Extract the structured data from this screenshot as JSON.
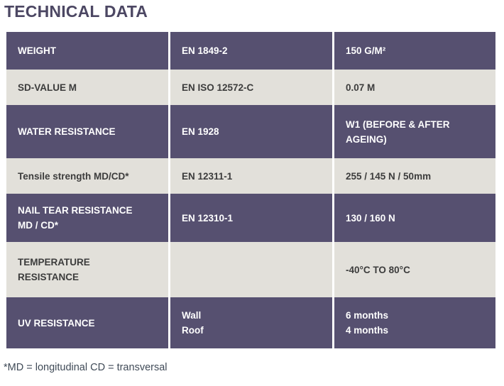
{
  "header": {
    "title": "TECHNICAL DATA"
  },
  "colors": {
    "band_purple": "#565070",
    "band_light": "#e2e0da",
    "title_text": "#4c4763",
    "light_row_text": "#3c3c3c",
    "muted_text": "#4a4a4a",
    "footnote_text": "#3f4a57",
    "page_background": "#ffffff"
  },
  "table": {
    "rows": [
      {
        "style": "dark",
        "property": "WEIGHT",
        "standard": "EN 1849-2",
        "value": "150 G/M²"
      },
      {
        "style": "light",
        "property": "SD-VALUE M",
        "standard": "EN ISO 12572-C",
        "value": "0.07 M"
      },
      {
        "style": "dark",
        "property": "WATER RESISTANCE",
        "standard": "EN 1928",
        "value_line1": "W1 (BEFORE & AFTER",
        "value_line2": "AGEING)"
      },
      {
        "style": "light",
        "property": "Tensile strength MD/CD*",
        "standard": "EN 12311-1",
        "value": "255 / 145 N / 50mm"
      },
      {
        "style": "dark",
        "property_line1": "NAIL TEAR RESISTANCE",
        "property_line2": "MD / CD*",
        "standard": "EN 12310-1",
        "value": "130 / 160 N"
      },
      {
        "style": "light",
        "property_line1": "TEMPERATURE",
        "property_line2": "RESISTANCE",
        "standard": "",
        "value": "-40°C TO 80°C"
      },
      {
        "style": "dark",
        "property": "UV RESISTANCE",
        "standard_line1": "Wall",
        "standard_line2": "Roof",
        "value_line1": "6 months",
        "value_line2": "4 months"
      }
    ]
  },
  "footnote": {
    "text": "*MD = longitudinal CD = transversal"
  }
}
